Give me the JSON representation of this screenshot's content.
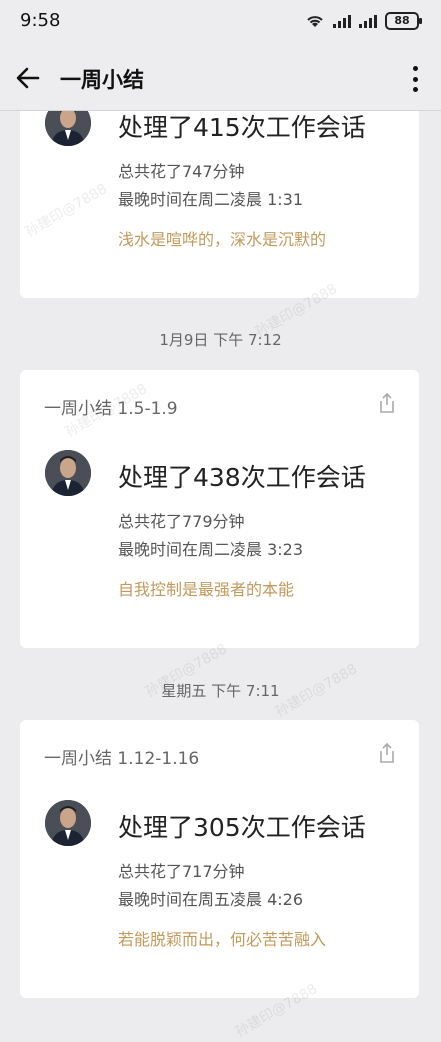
{
  "status_bar": {
    "time": "9:58",
    "battery": "88"
  },
  "app_bar": {
    "title": "一周小结"
  },
  "cards": [
    {
      "headline": "处理了415次工作会话",
      "total": "总共花了747分钟",
      "latest": "最晚时间在周二凌晨 1:31",
      "quote": "浅水是喧哗的，深水是沉默的"
    },
    {
      "header": "一周小结 1.5-1.9",
      "headline": "处理了438次工作会话",
      "total": "总共花了779分钟",
      "latest": "最晚时间在周二凌晨 3:23",
      "quote": "自我控制是最强者的本能"
    },
    {
      "header": "一周小结 1.12-1.16",
      "headline": "处理了305次工作会话",
      "total": "总共花了717分钟",
      "latest": "最晚时间在周五凌晨 4:26",
      "quote": "若能脱颖而出，何必苦苦融入"
    }
  ],
  "date_separators": [
    "1月9日  下午 7:12",
    "星期五  下午 7:11"
  ],
  "watermark_text": "孙建印@7888",
  "colors": {
    "background": "#ececef",
    "card": "#ffffff",
    "quote": "#c19a5b"
  }
}
